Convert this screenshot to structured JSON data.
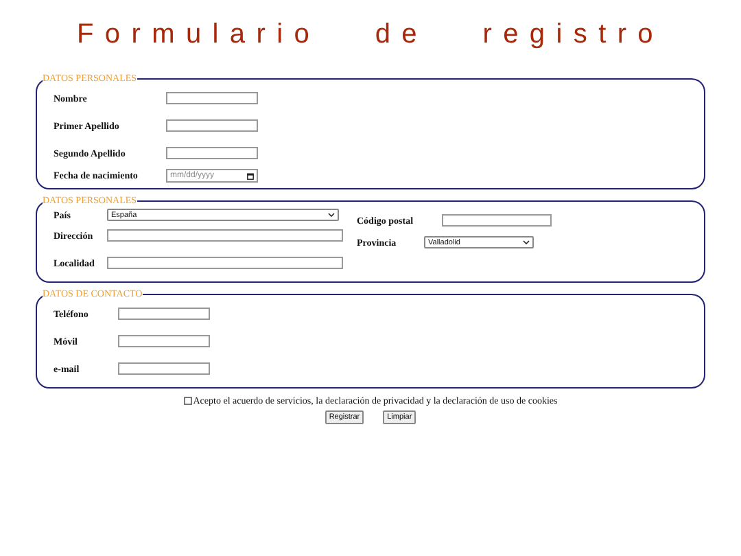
{
  "title": "Formulario de registro",
  "sections": [
    {
      "legend": "DATOS PERSONALES",
      "kind": "single",
      "columns": [
        [
          {
            "label": "Nombre",
            "kind": "text"
          },
          {
            "label": "Primer Apellido",
            "kind": "text"
          },
          {
            "label": "Segundo Apellido",
            "kind": "text"
          },
          {
            "label": "Fecha de nacimiento",
            "kind": "date",
            "placeholder": "mm/dd/yyyy"
          }
        ]
      ]
    },
    {
      "legend": "DATOS PERSONALES",
      "kind": "address",
      "columns": [
        [
          {
            "label": "País",
            "kind": "select",
            "value": "España"
          },
          {
            "label": "Dirección",
            "kind": "text"
          },
          {
            "label": "Localidad",
            "kind": "text"
          }
        ],
        [
          {
            "label": "Código postal",
            "kind": "text"
          },
          {
            "label": "Provincia",
            "kind": "select",
            "value": "Valladolid"
          }
        ]
      ]
    },
    {
      "legend": "DATOS DE CONTACTO",
      "kind": "contact",
      "columns": [
        [
          {
            "label": "Teléfono",
            "kind": "text"
          },
          {
            "label": "Móvil",
            "kind": "text"
          },
          {
            "label": "e-mail",
            "kind": "text"
          }
        ]
      ]
    }
  ],
  "agreement": {
    "label": "Acepto el acuerdo de servicios, la declaración de privacidad y la declaración de uso de cookies",
    "checked": false
  },
  "buttons": [
    "Registrar",
    "Limpiar"
  ]
}
